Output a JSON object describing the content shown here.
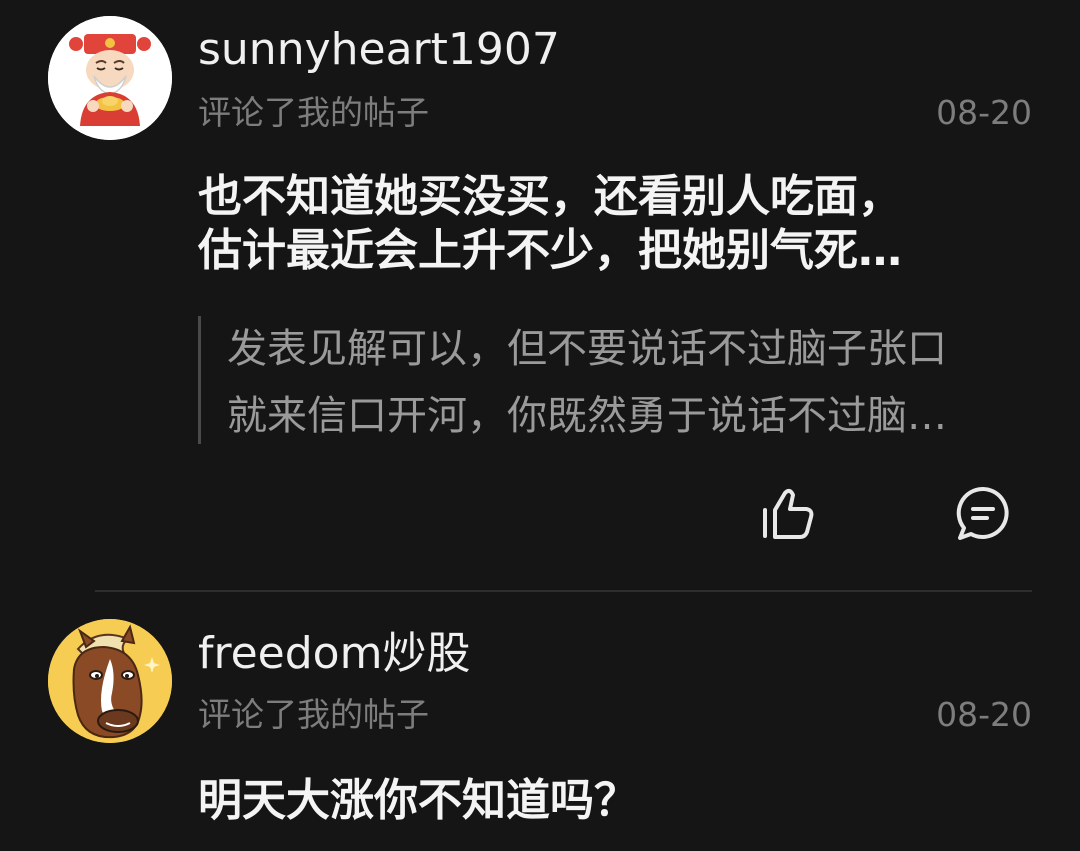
{
  "comments": [
    {
      "username": "sunnyheart1907",
      "action": "评论了我的帖子",
      "date": "08-20",
      "avatar_icon": "fortune-god-avatar-icon",
      "content_lines": [
        "也不知道她买没买，还看别人吃面，",
        "估计最近会上升不少，把她别气死…"
      ],
      "quoted_lines": [
        "发表见解可以，但不要说话不过脑子张口",
        "就来信口开河，你既然勇于说话不过脑…"
      ],
      "actions": {
        "like_icon": "thumbs-up-icon",
        "reply_icon": "comment-bubble-icon"
      }
    },
    {
      "username": "freedom炒股",
      "action": "评论了我的帖子",
      "date": "08-20",
      "avatar_icon": "horse-avatar-icon",
      "content_lines": [
        "明天大涨你不知道吗？"
      ]
    }
  ],
  "colors": {
    "background": "#151515",
    "primary_text": "#f0f0f0",
    "secondary_text": "#7d7d7d",
    "quote_text": "#9a9a9a",
    "divider": "#2e2e2e"
  }
}
